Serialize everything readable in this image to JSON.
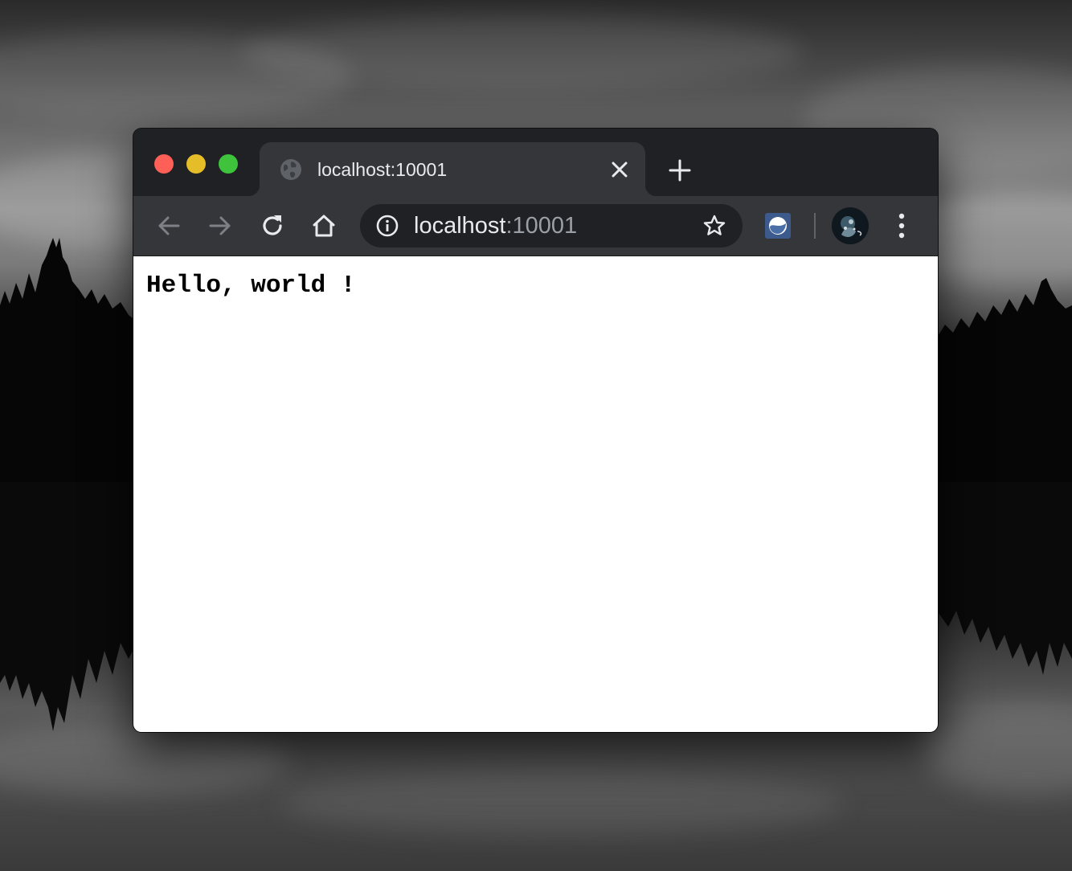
{
  "window": {
    "tab_title": "localhost:10001",
    "tab_favicon": "globe-icon",
    "tab_close_icon": "close-icon",
    "new_tab_icon": "plus-icon"
  },
  "toolbar": {
    "back_icon": "arrow-left-icon",
    "forward_icon": "arrow-right-icon",
    "reload_icon": "reload-icon",
    "home_icon": "home-icon",
    "site_info_icon": "info-icon",
    "url_host": "localhost",
    "url_port": ":10001",
    "bookmark_icon": "star-icon",
    "extension_icon": "extension-icon",
    "menu_icon": "more-vert-icon"
  },
  "page": {
    "content": "Hello, world !"
  },
  "colors": {
    "titlebar": "#202124",
    "toolbar": "#35363a",
    "omnibox": "#202124",
    "traffic_close": "#fe5f57",
    "traffic_minimize": "#e4bd28",
    "traffic_maximize": "#3fc33c",
    "page_background": "#ffffff"
  }
}
